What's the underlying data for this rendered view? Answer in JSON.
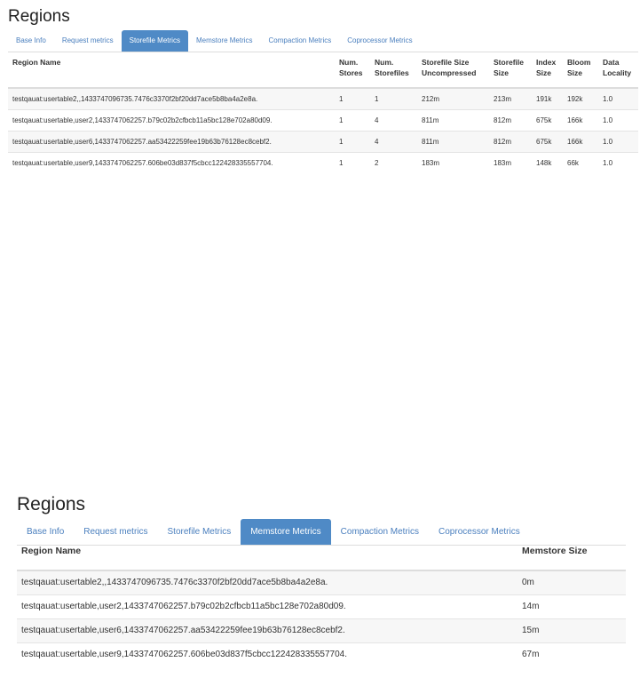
{
  "top": {
    "title": "Regions",
    "tabs": [
      "Base Info",
      "Request metrics",
      "Storefile Metrics",
      "Memstore Metrics",
      "Compaction Metrics",
      "Coprocessor Metrics"
    ],
    "active_tab": "Storefile Metrics",
    "columns": [
      [
        "Region Name"
      ],
      [
        "Num.",
        "Stores"
      ],
      [
        "Num.",
        "Storefiles"
      ],
      [
        "Storefile Size",
        "Uncompressed"
      ],
      [
        "Storefile",
        "Size"
      ],
      [
        "Index",
        "Size"
      ],
      [
        "Bloom",
        "Size"
      ],
      [
        "Data",
        "Locality"
      ]
    ],
    "rows": [
      [
        "testqauat:usertable2,,1433747096735.7476c3370f2bf20dd7ace5b8ba4a2e8a.",
        "1",
        "1",
        "212m",
        "213m",
        "191k",
        "192k",
        "1.0"
      ],
      [
        "testqauat:usertable,user2,1433747062257.b79c02b2cfbcb11a5bc128e702a80d09.",
        "1",
        "4",
        "811m",
        "812m",
        "675k",
        "166k",
        "1.0"
      ],
      [
        "testqauat:usertable,user6,1433747062257.aa53422259fee19b63b76128ec8cebf2.",
        "1",
        "4",
        "811m",
        "812m",
        "675k",
        "166k",
        "1.0"
      ],
      [
        "testqauat:usertable,user9,1433747062257.606be03d837f5cbcc122428335557704.",
        "1",
        "2",
        "183m",
        "183m",
        "148k",
        "66k",
        "1.0"
      ]
    ]
  },
  "bottom": {
    "title": "Regions",
    "tabs": [
      "Base Info",
      "Request metrics",
      "Storefile Metrics",
      "Memstore Metrics",
      "Compaction Metrics",
      "Coprocessor Metrics"
    ],
    "active_tab": "Memstore Metrics",
    "columns": [
      "Region Name",
      "Memstore Size"
    ],
    "rows": [
      [
        "testqauat:usertable2,,1433747096735.7476c3370f2bf20dd7ace5b8ba4a2e8a.",
        "0m"
      ],
      [
        "testqauat:usertable,user2,1433747062257.b79c02b2cfbcb11a5bc128e702a80d09.",
        "14m"
      ],
      [
        "testqauat:usertable,user6,1433747062257.aa53422259fee19b63b76128ec8cebf2.",
        "15m"
      ],
      [
        "testqauat:usertable,user9,1433747062257.606be03d837f5cbcc122428335557704.",
        "67m"
      ]
    ]
  }
}
